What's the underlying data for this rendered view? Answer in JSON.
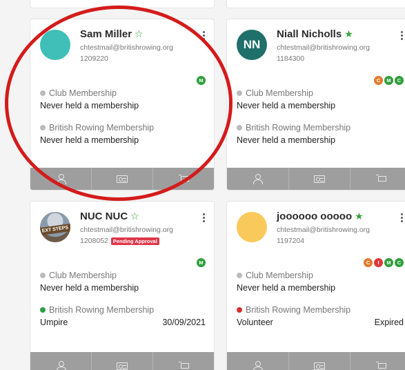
{
  "colors": {
    "badge_m": "#2e9e3a",
    "badge_c": "#e07b2e",
    "badge_i": "#d93a3a",
    "star": "#36a13a",
    "dot_green": "#2ea043",
    "dot_red": "#d32f2f",
    "dot_grey": "#bdbdbd",
    "annotation": "#d41b1b"
  },
  "cards": [
    {
      "name": "Sam Miller",
      "starred": false,
      "email": "chtestmail@britishrowing.org",
      "member_number": "1209220",
      "avatar": {
        "type": "color",
        "color": "#3fbfb8",
        "initials": ""
      },
      "badges": [
        "M"
      ],
      "club_label": "Club Membership",
      "club_value": "Never held a membership",
      "br_label": "British Rowing Membership",
      "br_value": "Never held a membership",
      "br_date": "",
      "br_status": "none"
    },
    {
      "name": "Niall Nicholls",
      "starred": true,
      "email": "chtestmail@britishrowing.org",
      "member_number": "1184300",
      "avatar": {
        "type": "initials",
        "color": "#1f6f6a",
        "initials": "NN"
      },
      "badges": [
        "C",
        "M",
        "C"
      ],
      "club_label": "Club Membership",
      "club_value": "Never held a membership",
      "br_label": "British Rowing Membership",
      "br_value": "Never held a membership",
      "br_date": "",
      "br_status": "none"
    },
    {
      "name": "NUC NUC",
      "starred": false,
      "email": "chtestmail@britishrowing.org",
      "member_number": "1208052",
      "pending": "Pending Approval",
      "avatar": {
        "type": "image",
        "sign_text": "EXT STEPS"
      },
      "badges": [
        "M"
      ],
      "club_label": "Club Membership",
      "club_value": "Never held a membership",
      "br_label": "British Rowing Membership",
      "br_value": "Umpire",
      "br_date": "30/09/2021",
      "br_status": "active"
    },
    {
      "name": "joooooo ooooo",
      "starred": true,
      "email": "chtestmail@britishrowing.org",
      "member_number": "1197204",
      "avatar": {
        "type": "color",
        "color": "#f9c95b",
        "initials": ""
      },
      "badges": [
        "C",
        "I",
        "M",
        "C"
      ],
      "club_label": "Club Membership",
      "club_value": "Never held a membership",
      "br_label": "British Rowing Membership",
      "br_value": "Volunteer",
      "br_date": "Expired",
      "br_status": "expired"
    }
  ],
  "footer_icons": [
    "person-icon",
    "id-card-icon",
    "cart-icon"
  ]
}
